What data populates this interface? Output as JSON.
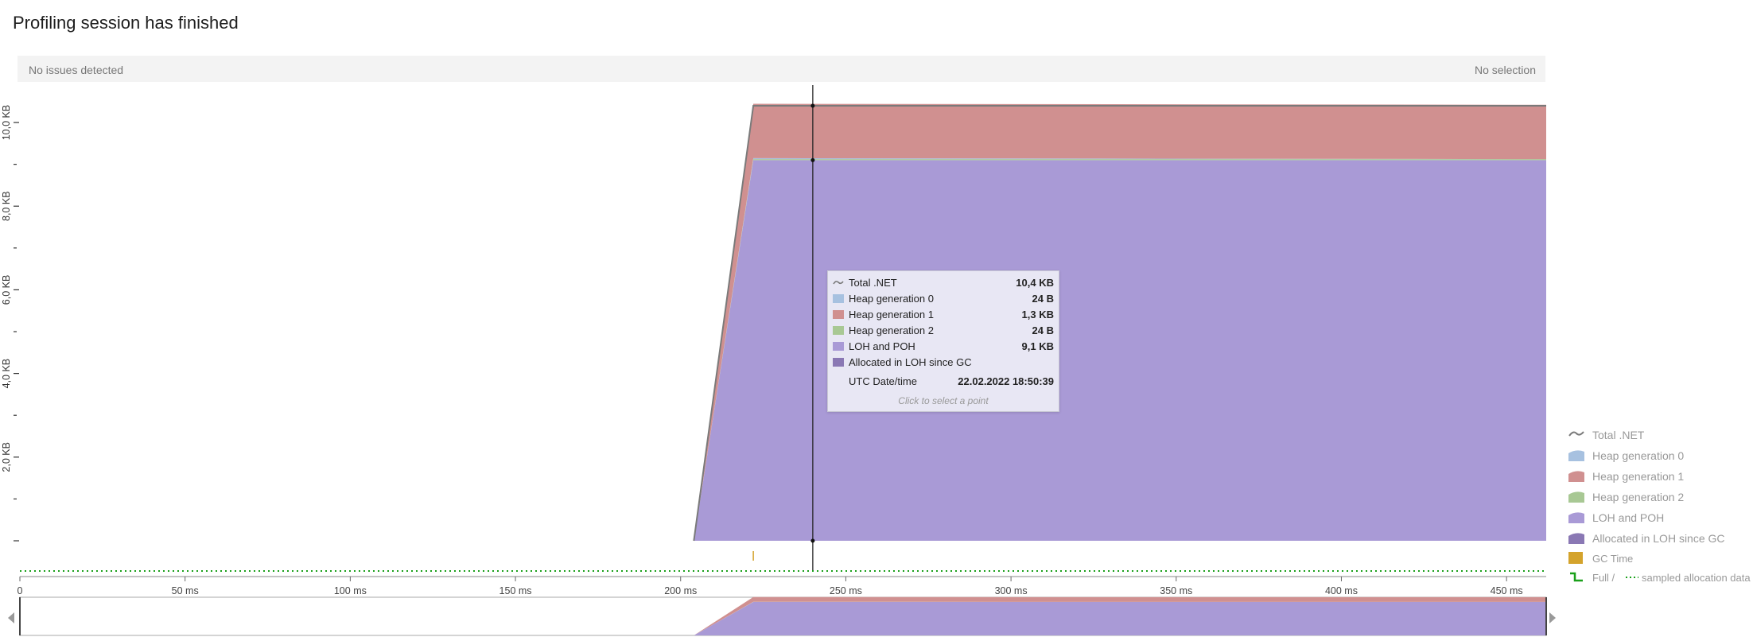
{
  "header": {
    "title": "Profiling session has finished"
  },
  "status": {
    "issues": "No issues detected",
    "selection": "No selection"
  },
  "chart_data": {
    "type": "area",
    "x_unit": "ms",
    "xlim": [
      0,
      462
    ],
    "x_ticks": [
      {
        "value": 0,
        "label": "0"
      },
      {
        "value": 50,
        "label": "50 ms"
      },
      {
        "value": 100,
        "label": "100 ms"
      },
      {
        "value": 150,
        "label": "150 ms"
      },
      {
        "value": 200,
        "label": "200 ms"
      },
      {
        "value": 250,
        "label": "250 ms"
      },
      {
        "value": 300,
        "label": "300 ms"
      },
      {
        "value": 350,
        "label": "350 ms"
      },
      {
        "value": 400,
        "label": "400 ms"
      },
      {
        "value": 450,
        "label": "450 ms"
      }
    ],
    "y_unit": "KB",
    "ylim": [
      0,
      10.4
    ],
    "y_ticks": [
      {
        "value": 2,
        "label": "2,0 KB"
      },
      {
        "value": 4,
        "label": "4,0 KB"
      },
      {
        "value": 6,
        "label": "6,0 KB"
      },
      {
        "value": 8,
        "label": "8,0 KB"
      },
      {
        "value": 10,
        "label": "10,0 KB"
      }
    ],
    "stack_x": [
      204,
      222,
      462
    ],
    "series": [
      {
        "name": "LOH and POH",
        "color": "#a99ad6",
        "values": [
          0,
          9.1,
          9.1
        ]
      },
      {
        "name": "Heap generation 2",
        "color": "#a8c894",
        "values": [
          0,
          0.024,
          0.024
        ]
      },
      {
        "name": "Heap generation 0",
        "color": "#a7c1e0",
        "values": [
          0,
          0.024,
          0
        ]
      },
      {
        "name": "Heap generation 1",
        "color": "#d09090",
        "values": [
          0,
          1.3,
          1.3
        ]
      }
    ],
    "total_line": {
      "name": "Total .NET",
      "color": "#7a7a7a",
      "values": [
        0,
        10.4,
        10.4
      ]
    },
    "cursor_x": 240,
    "gc_marks": [
      222
    ],
    "sampled_allocation_color": "#1aa01a"
  },
  "tooltip": {
    "rows": [
      {
        "label": "Total .NET",
        "value": "10,4 KB",
        "color": "#7a7a7a",
        "icon": "line-icon"
      },
      {
        "label": "Heap generation 0",
        "value": "24 B",
        "color": "#a7c1e0",
        "icon": "area-icon"
      },
      {
        "label": "Heap generation 1",
        "value": "1,3 KB",
        "color": "#d09090",
        "icon": "area-icon"
      },
      {
        "label": "Heap generation 2",
        "value": "24 B",
        "color": "#a8c894",
        "icon": "area-icon"
      },
      {
        "label": "LOH and POH",
        "value": "9,1 KB",
        "color": "#a99ad6",
        "icon": "area-icon"
      },
      {
        "label": "Allocated in LOH since GC",
        "value": "",
        "color": "#8a78b4",
        "icon": "area-icon"
      }
    ],
    "datetime_label": "UTC Date/time",
    "datetime_value": "22.02.2022 18:50:39",
    "hint": "Click to select a point"
  },
  "legend": {
    "items": [
      {
        "label": "Total .NET",
        "color": "#7a7a7a",
        "icon": "line-icon"
      },
      {
        "label": "Heap generation 0",
        "color": "#a7c1e0",
        "icon": "area-icon"
      },
      {
        "label": "Heap generation 1",
        "color": "#d09090",
        "icon": "area-icon"
      },
      {
        "label": "Heap generation 2",
        "color": "#a8c894",
        "icon": "area-icon"
      },
      {
        "label": "LOH and POH",
        "color": "#a99ad6",
        "icon": "area-icon"
      },
      {
        "label": "Allocated in LOH since GC",
        "color": "#8a78b4",
        "icon": "area-icon"
      },
      {
        "label": "GC Time",
        "color": "#d4a32c",
        "icon": "square-icon"
      }
    ],
    "full_label": "Full /",
    "sampled_label": "sampled allocation data",
    "full_color": "#1aa01a"
  }
}
